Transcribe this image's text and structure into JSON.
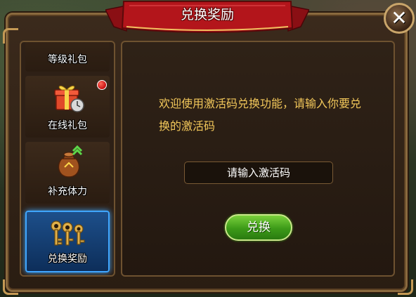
{
  "dialog": {
    "title": "兑换奖励",
    "close_label": "✕"
  },
  "sidebar": {
    "items": [
      {
        "label": "等级礼包",
        "icon": "level-gift-icon"
      },
      {
        "label": "在线礼包",
        "icon": "online-gift-icon",
        "has_notification": true
      },
      {
        "label": "补充体力",
        "icon": "stamina-bag-icon",
        "has_upgrade_arrow": true
      },
      {
        "label": "兑换奖励",
        "icon": "keys-icon",
        "selected": true
      }
    ]
  },
  "main": {
    "message": "欢迎使用激活码兑换功能，请输入你要兑换的激活码",
    "code_input": {
      "value": "",
      "placeholder": "请输入激活码"
    },
    "redeem_button": "兑换"
  },
  "colors": {
    "accent_text": "#f2c75a",
    "selected_border": "#3fa6ff",
    "button_green": "#3c9a18",
    "ribbon_red": "#b3151b"
  }
}
